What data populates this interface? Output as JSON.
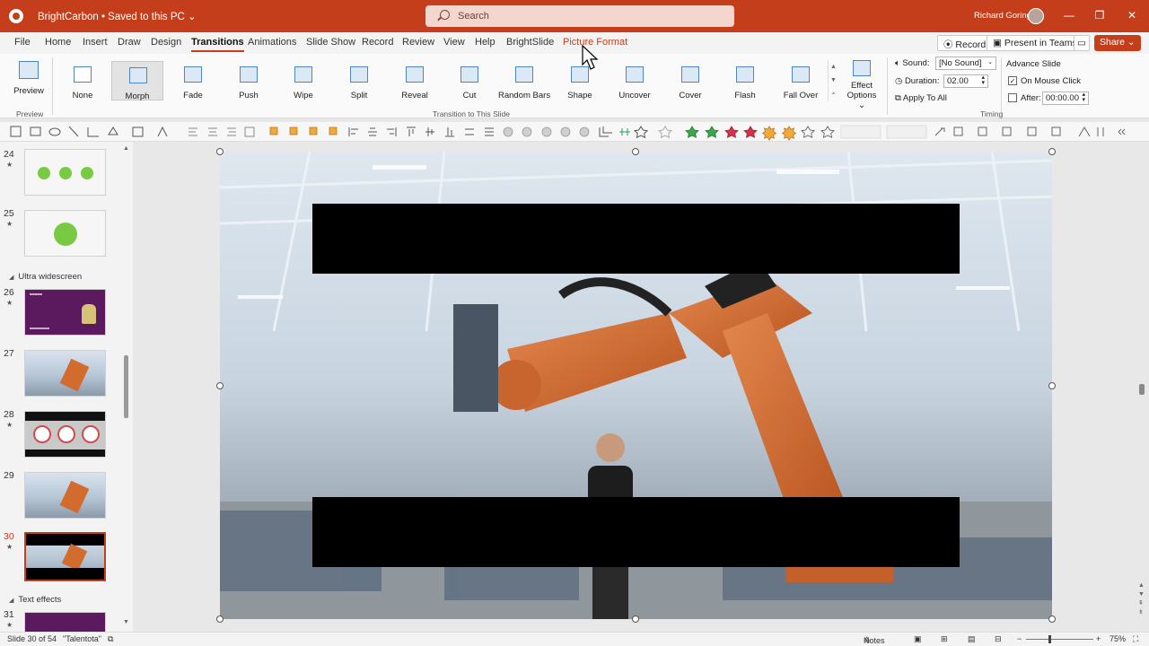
{
  "title_bar": {
    "doc_title": "BrightCarbon • Saved to this PC ⌄",
    "search_placeholder": "Search",
    "user_name": "Richard Goring",
    "minimize": "—",
    "restore": "❐",
    "close": "✕"
  },
  "menu": {
    "tabs": [
      "File",
      "Home",
      "Insert",
      "Draw",
      "Design",
      "Transitions",
      "Animations",
      "Slide Show",
      "Record",
      "Review",
      "View",
      "Help",
      "BrightSlide",
      "Picture Format"
    ],
    "active_tab": "Transitions",
    "record_button": "Record",
    "teams_button": "Present in Teams",
    "share_button": "Share ⌄"
  },
  "ribbon": {
    "preview_label": "Preview",
    "preview_group": "Preview",
    "transitions": [
      "None",
      "Morph",
      "Fade",
      "Push",
      "Wipe",
      "Split",
      "Reveal",
      "Cut",
      "Random Bars",
      "Shape",
      "Uncover",
      "Cover",
      "Flash",
      "Fall Over"
    ],
    "selected_transition": "Morph",
    "transitions_group": "Transition to This Slide",
    "effect_options": "Effect Options ⌄",
    "sound_label": "Sound:",
    "sound_value": "[No Sound]",
    "duration_label": "Duration:",
    "duration_value": "02.00",
    "apply_all": "Apply To All",
    "advance_title": "Advance Slide",
    "on_mouse_click": "On Mouse Click",
    "after_label": "After:",
    "after_value": "00:00.00",
    "timing_group": "Timing",
    "on_mouse_click_checked": true,
    "after_checked": false
  },
  "thumbnails": {
    "slides": [
      {
        "num": "24",
        "kind": "dots"
      },
      {
        "num": "25",
        "kind": "circle"
      },
      {
        "num": "26",
        "kind": "purple"
      },
      {
        "num": "27",
        "kind": "photo"
      },
      {
        "num": "28",
        "kind": "dark"
      },
      {
        "num": "29",
        "kind": "photo"
      },
      {
        "num": "30",
        "kind": "photo-bars",
        "current": true
      },
      {
        "num": "31",
        "kind": "purple"
      }
    ],
    "sections": [
      "Ultra widescreen",
      "Text effects"
    ]
  },
  "status_bar": {
    "slide_info": "Slide 30 of 54",
    "theme": "\"Talentota\"",
    "notes": "Notes",
    "zoom": "75%"
  },
  "colors": {
    "accent": "#c43e1c",
    "green": "#7ac943",
    "purple": "#5b1a5e"
  }
}
